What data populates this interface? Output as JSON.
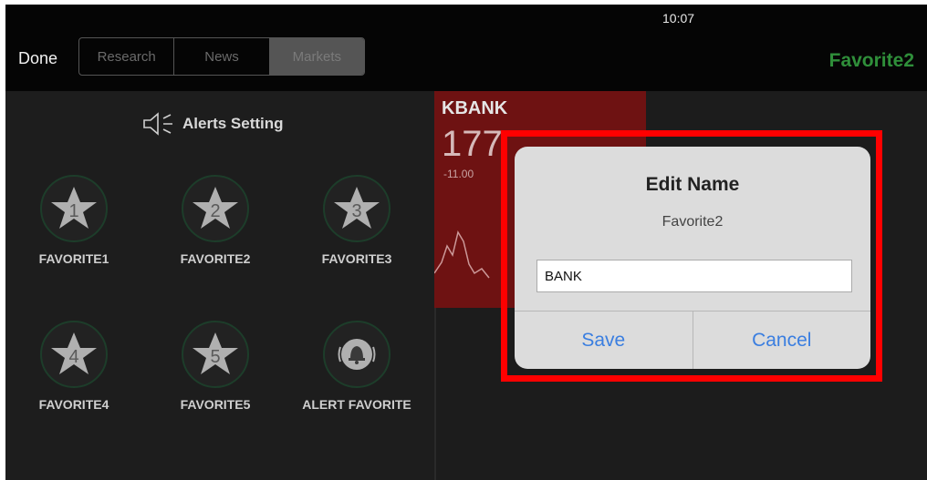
{
  "status": {
    "time": "10:07"
  },
  "nav": {
    "done_label": "Done",
    "tabs": [
      "Research",
      "News",
      "Markets"
    ],
    "favorite_title": "Favorite2"
  },
  "alerts_setting": {
    "label": "Alerts Setting",
    "icon": "speaker-icon"
  },
  "favorites": [
    {
      "label": "FAVORITE1",
      "number": "1",
      "icon": "star-icon"
    },
    {
      "label": "FAVORITE2",
      "number": "2",
      "icon": "star-icon"
    },
    {
      "label": "FAVORITE3",
      "number": "3",
      "icon": "star-icon"
    },
    {
      "label": "FAVORITE4",
      "number": "4",
      "icon": "star-icon"
    },
    {
      "label": "FAVORITE5",
      "number": "5",
      "icon": "star-icon"
    },
    {
      "label": "ALERT FAVORITE",
      "icon": "bell-icon"
    }
  ],
  "stock_card": {
    "ticker": "KBANK",
    "price_partial": "177",
    "change_partial": "-11.00"
  },
  "dialog": {
    "title": "Edit Name",
    "message": "Favorite2",
    "input_value": "BANK",
    "save_label": "Save",
    "cancel_label": "Cancel"
  },
  "colors": {
    "background": "#1c1c1c",
    "accent_green": "#2f8f3a",
    "stock_card_red": "#6e1212",
    "dialog_bg": "#dcdcdc",
    "button_blue": "#3a7ee0",
    "highlight_red": "#ff0000"
  }
}
